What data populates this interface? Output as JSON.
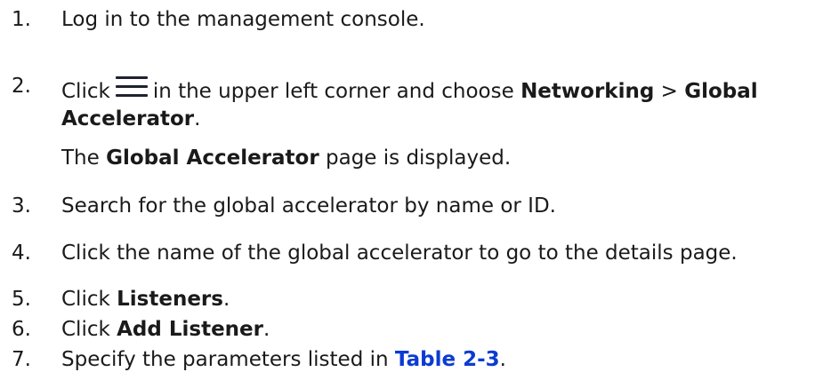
{
  "steps": [
    {
      "num": "1.",
      "text": "Log in to the management console."
    },
    {
      "num": "2.",
      "pre": "Click",
      "icon": "hamburger-menu-icon",
      "mid": "in the upper left corner and choose",
      "bold1": "Networking",
      "sep": ">",
      "bold2": "Global Accelerator",
      "end": ".",
      "note_pre": "The",
      "note_bold": "Global Accelerator",
      "note_post": "page is displayed."
    },
    {
      "num": "3.",
      "text": "Search for the global accelerator by name or ID."
    },
    {
      "num": "4.",
      "text": "Click the name of the global accelerator to go to the details page."
    },
    {
      "num": "5.",
      "pre": "Click",
      "bold": "Listeners",
      "end": "."
    },
    {
      "num": "6.",
      "pre": "Click",
      "bold": "Add Listener",
      "end": "."
    },
    {
      "num": "7.",
      "pre": "Specify the parameters listed in",
      "link": "Table 2-3",
      "end": "."
    }
  ],
  "colors": {
    "text": "#1a1a1a",
    "link": "#0b3bd3"
  }
}
